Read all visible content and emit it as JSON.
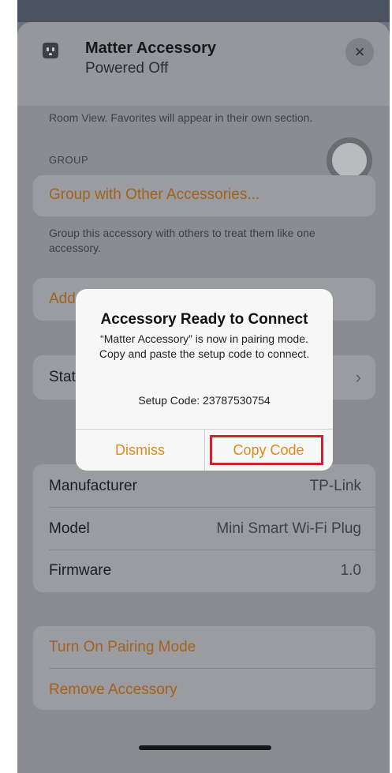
{
  "header": {
    "title": "Matter Accessory",
    "subtitle": "Powered Off",
    "close_glyph": "×",
    "accessory_icon": "outlet-icon"
  },
  "favorites_note": "Room View. Favorites will appear in their own section.",
  "group": {
    "section_label": "GROUP",
    "link": "Group with Other Accessories...",
    "note": "Group this accessory with others to treat them like one accessory."
  },
  "add_row": {
    "label_partial": "Add"
  },
  "status_row": {
    "label_partial": "Stat",
    "chevron": "›"
  },
  "info": {
    "rows": [
      {
        "label": "Manufacturer",
        "value": "TP-Link"
      },
      {
        "label": "Model",
        "value": "Mini Smart Wi-Fi Plug"
      },
      {
        "label": "Firmware",
        "value": "1.0"
      }
    ]
  },
  "actions": {
    "pairing": "Turn On Pairing Mode",
    "remove": "Remove Accessory"
  },
  "alert": {
    "title": "Accessory Ready to Connect",
    "message": "“Matter Accessory” is now in pairing mode. Copy and paste the setup code to connect.",
    "setup_code": "Setup Code: 23787530754",
    "dismiss": "Dismiss",
    "copy": "Copy Code"
  },
  "colors": {
    "accent": "#e3891a",
    "accent_dimmed": "#a5621a",
    "highlight_box": "#d5202e",
    "overlay": "#8a8c91"
  }
}
